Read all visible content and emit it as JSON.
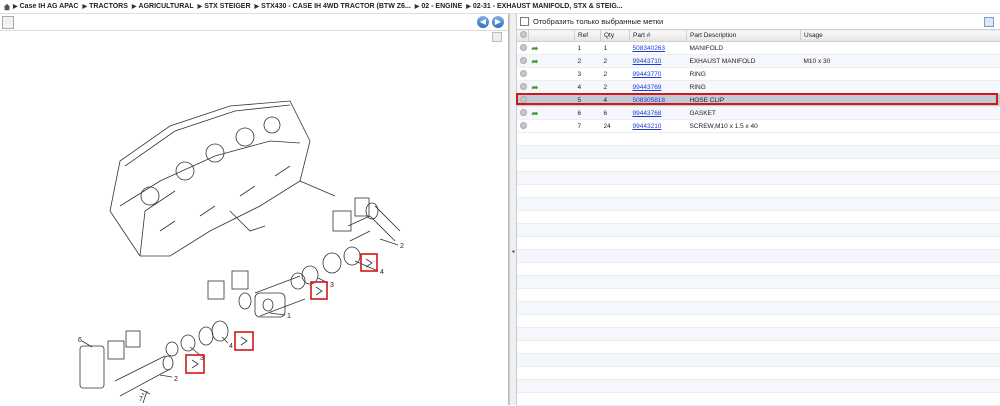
{
  "breadcrumb": [
    "Case IH AG APAC",
    "TRACTORS",
    "AGRICULTURAL",
    "STX STEIGER",
    "STX430 - CASE IH 4WD TRACTOR (BTW Z6...",
    "02 - ENGINE",
    "02-31 - EXHAUST MANIFOLD, STX & STEIG..."
  ],
  "diagram": {
    "callouts": [
      "2",
      "4",
      "3",
      "1",
      "4",
      "3",
      "6",
      "2",
      "7"
    ]
  },
  "filter": {
    "label": "Отобразить только выбранные метки"
  },
  "table": {
    "columns": [
      "Ref",
      "Qty",
      "Part #",
      "Part Description",
      "Usage"
    ],
    "rows": [
      {
        "ref": "1",
        "qty": "1",
        "part": "508340263",
        "desc": "MANIFOLD",
        "usage": ""
      },
      {
        "ref": "2",
        "qty": "2",
        "part": "99443710",
        "desc": "EXHAUST MANIFOLD",
        "usage": "M10 x 30"
      },
      {
        "ref": "3",
        "qty": "2",
        "part": "99443770",
        "desc": "RING",
        "usage": ""
      },
      {
        "ref": "4",
        "qty": "2",
        "part": "99443769",
        "desc": "RING",
        "usage": ""
      },
      {
        "ref": "5",
        "qty": "4",
        "part": "508305818",
        "desc": "HOSE CLIP",
        "usage": ""
      },
      {
        "ref": "6",
        "qty": "6",
        "part": "99443768",
        "desc": "GASKET",
        "usage": ""
      },
      {
        "ref": "7",
        "qty": "24",
        "part": "99443210",
        "desc": "SCREW,M10 x 1.5 x 40",
        "usage": ""
      }
    ]
  },
  "colors": {
    "highlight": "#d01818",
    "link": "#1a3fd6",
    "selected_row": "#c3cbd6"
  }
}
